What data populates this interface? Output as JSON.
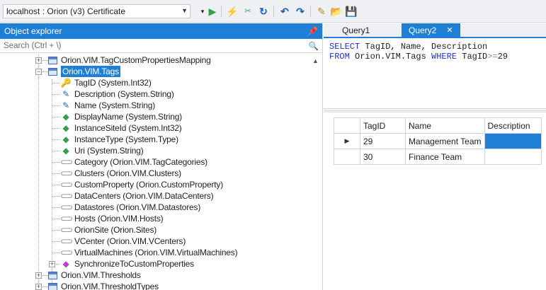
{
  "toolbar": {
    "connection": "localhost : Orion (v3) Certificate",
    "icons": [
      "dropdown-icon",
      "play-icon",
      "plug-icon",
      "disconnect-icon",
      "refresh-icon",
      "undo-icon",
      "redo-icon",
      "new-query-icon",
      "open-folder-icon",
      "save-icon"
    ]
  },
  "object_explorer": {
    "title": "Object explorer",
    "search_placeholder": "Search (Ctrl + \\)",
    "items": [
      {
        "label": "Orion.VIM.TagCustomPropertiesMapping",
        "icon": "table-icon"
      },
      {
        "label": "Orion.VIM.Tags",
        "icon": "table-icon",
        "selected": true
      },
      {
        "label": "TagID (System.Int32)",
        "icon": "key-icon"
      },
      {
        "label": "Description (System.String)",
        "icon": "pencil-icon"
      },
      {
        "label": "Name (System.String)",
        "icon": "pencil-icon"
      },
      {
        "label": "DisplayName (System.String)",
        "icon": "green-property-icon"
      },
      {
        "label": "InstanceSiteId (System.Int32)",
        "icon": "green-property-icon"
      },
      {
        "label": "InstanceType (System.Type)",
        "icon": "green-property-icon"
      },
      {
        "label": "Uri (System.String)",
        "icon": "green-property-icon"
      },
      {
        "label": "Category (Orion.VIM.TagCategories)",
        "icon": "link-icon"
      },
      {
        "label": "Clusters (Orion.VIM.Clusters)",
        "icon": "link-icon"
      },
      {
        "label": "CustomProperty (Orion.CustomProperty)",
        "icon": "link-icon"
      },
      {
        "label": "DataCenters (Orion.VIM.DataCenters)",
        "icon": "link-icon"
      },
      {
        "label": "Datastores (Orion.VIM.Datastores)",
        "icon": "link-icon"
      },
      {
        "label": "Hosts (Orion.VIM.Hosts)",
        "icon": "link-icon"
      },
      {
        "label": "OrionSite (Orion.Sites)",
        "icon": "link-icon"
      },
      {
        "label": "VCenter (Orion.VIM.VCenters)",
        "icon": "link-icon"
      },
      {
        "label": "VirtualMachines (Orion.VIM.VirtualMachines)",
        "icon": "link-icon"
      },
      {
        "label": "SynchronizeToCustomProperties",
        "icon": "verb-icon"
      },
      {
        "label": "Orion.VIM.Thresholds",
        "icon": "table-icon"
      },
      {
        "label": "Orion.VIM.ThresholdTypes",
        "icon": "table-icon"
      }
    ]
  },
  "tabs": [
    {
      "label": "Query1",
      "active": false
    },
    {
      "label": "Query2",
      "active": true,
      "close": "✕"
    }
  ],
  "query": {
    "line1": {
      "kw1": "SELECT",
      "rest": " TagID, Name, Description"
    },
    "line2": {
      "kw1": "FROM",
      "mid": " Orion.VIM.Tags ",
      "kw2": "WHERE",
      "col": " TagID",
      "op": ">=",
      "num": "29"
    }
  },
  "results": {
    "columns": [
      "TagID",
      "Name",
      "Description"
    ],
    "rows": [
      {
        "indicator": "▶",
        "TagID": "29",
        "Name": "Management Team",
        "Description": ""
      },
      {
        "indicator": "",
        "TagID": "30",
        "Name": "Finance Team",
        "Description": ""
      }
    ]
  }
}
